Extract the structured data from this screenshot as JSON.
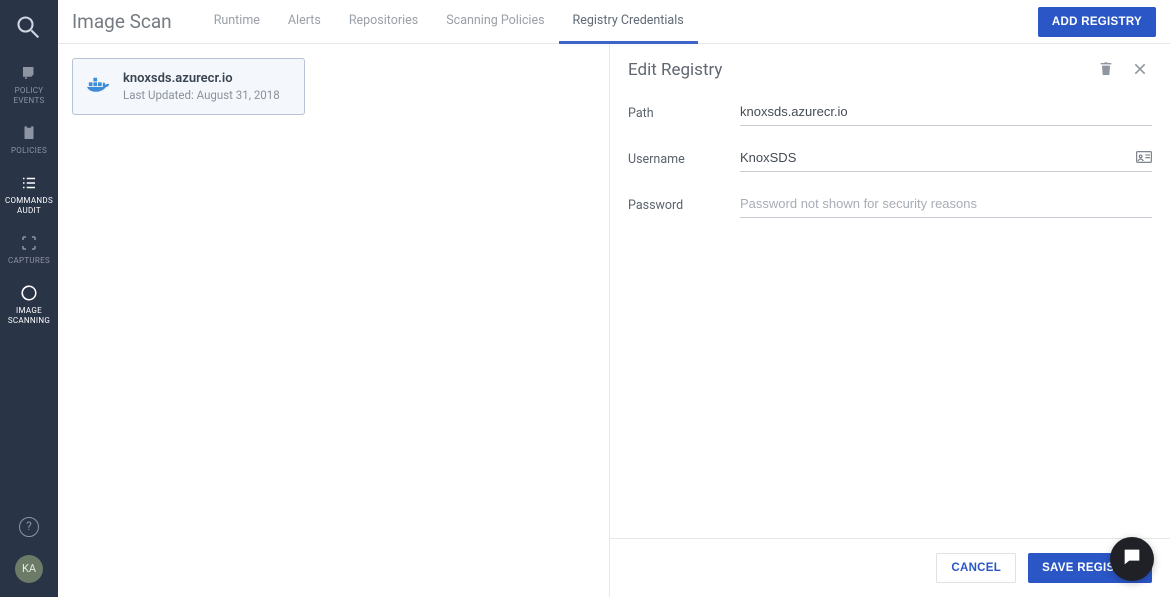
{
  "sidebar": {
    "items": [
      {
        "label": "POLICY EVENTS"
      },
      {
        "label": "POLICIES"
      },
      {
        "label": "COMMANDS AUDIT"
      },
      {
        "label": "CAPTURES"
      },
      {
        "label": "IMAGE SCANNING"
      }
    ],
    "avatar_initials": "KA"
  },
  "header": {
    "title": "Image Scan",
    "tabs": [
      {
        "label": "Runtime"
      },
      {
        "label": "Alerts"
      },
      {
        "label": "Repositories"
      },
      {
        "label": "Scanning Policies"
      },
      {
        "label": "Registry Credentials"
      }
    ],
    "active_tab_index": 4,
    "add_button_label": "ADD REGISTRY"
  },
  "registry_list": [
    {
      "name": "knoxsds.azurecr.io",
      "updated_label": "Last Updated:",
      "updated_value": "August 31, 2018"
    }
  ],
  "edit": {
    "heading": "Edit Registry",
    "fields": {
      "path": {
        "label": "Path",
        "value": "knoxsds.azurecr.io"
      },
      "username": {
        "label": "Username",
        "value": "KnoxSDS"
      },
      "password": {
        "label": "Password",
        "value": "",
        "placeholder": "Password not shown for security reasons"
      }
    },
    "cancel_label": "CANCEL",
    "save_label": "SAVE REGISTRY"
  },
  "colors": {
    "accent": "#2a56c6",
    "rail": "#2a3447"
  }
}
